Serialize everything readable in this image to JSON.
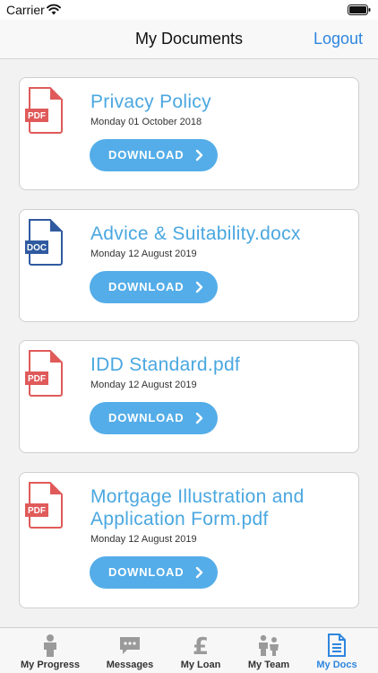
{
  "status_bar": {
    "carrier": "Carrier",
    "time": "",
    "icons": [
      "wifi-icon",
      "battery-icon"
    ]
  },
  "nav": {
    "title": "My Documents",
    "logout_label": "Logout"
  },
  "colors": {
    "accent": "#4aa7e0",
    "button": "#54ade8",
    "pdf_icon": "#e05a5a",
    "doc_icon": "#2f5aa0",
    "tab_active": "#2e86de",
    "tab_inactive": "#9a9a9a"
  },
  "documents": [
    {
      "title": "Privacy Policy",
      "date": "Monday 01 October 2018",
      "file_type": "PDF",
      "icon": "pdf-file-icon",
      "download_label": "DOWNLOAD"
    },
    {
      "title": "Advice & Suitability.docx",
      "date": "Monday 12 August 2019",
      "file_type": "DOC",
      "icon": "doc-file-icon",
      "download_label": "DOWNLOAD"
    },
    {
      "title": "IDD Standard.pdf",
      "date": "Monday 12 August 2019",
      "file_type": "PDF",
      "icon": "pdf-file-icon",
      "download_label": "DOWNLOAD"
    },
    {
      "title": "Mortgage Illustration and Application Form.pdf",
      "date": "Monday 12 August 2019",
      "file_type": "PDF",
      "icon": "pdf-file-icon",
      "download_label": "DOWNLOAD"
    }
  ],
  "tabs": [
    {
      "label": "My Progress",
      "icon": "person-icon",
      "active": false
    },
    {
      "label": "Messages",
      "icon": "chat-icon",
      "active": false
    },
    {
      "label": "My Loan",
      "icon": "pound-icon",
      "active": false
    },
    {
      "label": "My Team",
      "icon": "team-icon",
      "active": false
    },
    {
      "label": "My Docs",
      "icon": "document-icon",
      "active": true
    }
  ]
}
